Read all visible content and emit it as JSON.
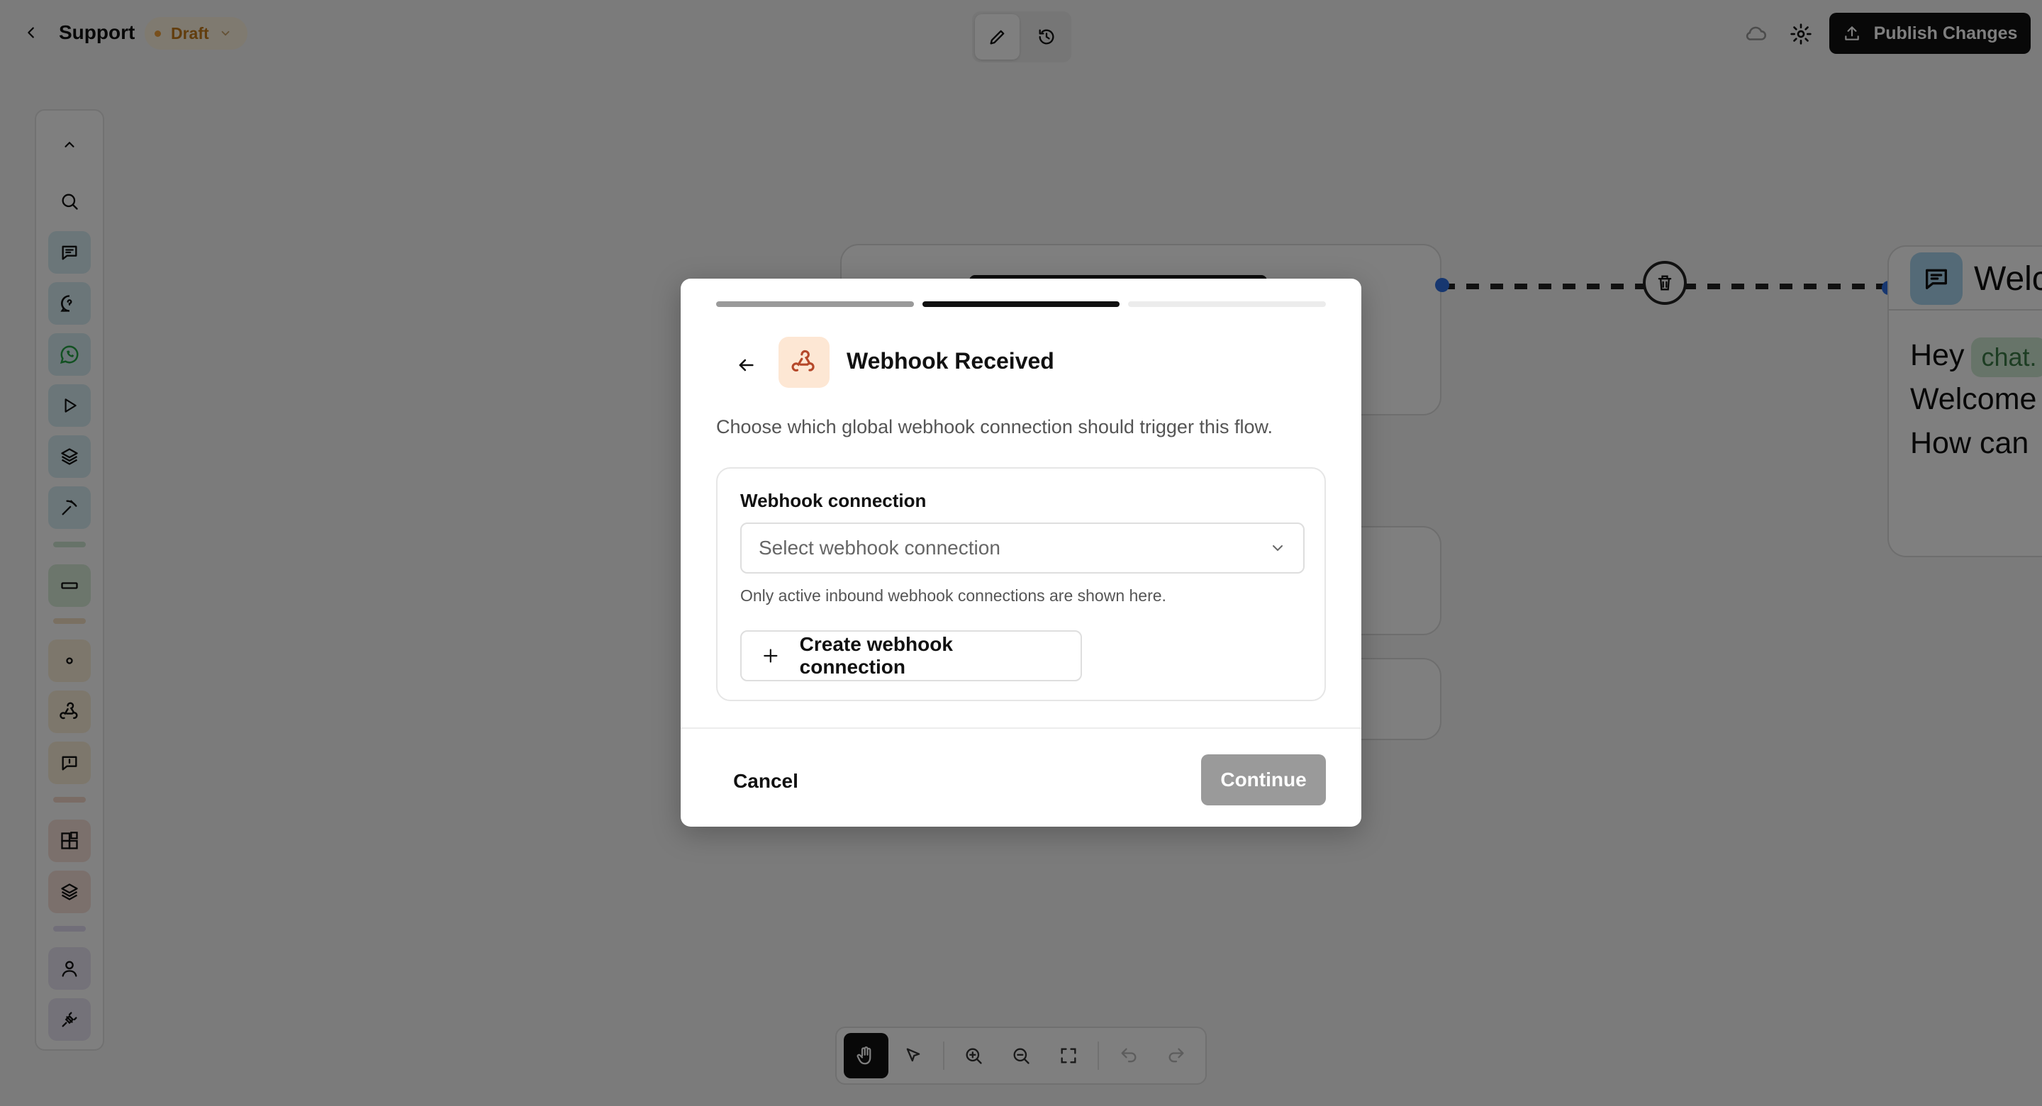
{
  "header": {
    "title": "Support",
    "status": "Draft",
    "publish_label": "Publish Changes"
  },
  "canvas": {
    "welcome_node": {
      "title": "Welc",
      "line1": "Hey",
      "variable": "chat.",
      "line2": "Welcome",
      "line3": "How can"
    }
  },
  "palette": {
    "items": [
      {
        "icon": "chevron-up-icon"
      },
      {
        "icon": "search-icon"
      },
      {
        "icon": "message-icon",
        "color": "#d6ecf3"
      },
      {
        "icon": "question-chat-icon",
        "color": "#d6ecf3"
      },
      {
        "icon": "whatsapp-icon",
        "color": "#d6ecf3"
      },
      {
        "icon": "play-icon",
        "color": "#d6ecf3"
      },
      {
        "icon": "layers-icon",
        "color": "#d6ecf3"
      },
      {
        "icon": "pickaxe-icon",
        "color": "#d6ecf3"
      },
      {
        "icon": "input-field-icon",
        "color": "#d8ecd9"
      },
      {
        "icon": "dot-icon",
        "color": "#fbefd8"
      },
      {
        "icon": "webhook-icon",
        "color": "#fbefd8"
      },
      {
        "icon": "chat-bubble-icon",
        "color": "#fbefd8"
      },
      {
        "icon": "blocks-icon",
        "color": "#f6e0d8"
      },
      {
        "icon": "layers-icon",
        "color": "#f6e0d8"
      },
      {
        "icon": "user-icon",
        "color": "#e8e4f3"
      },
      {
        "icon": "plug-icon",
        "color": "#e8e4f3"
      }
    ]
  },
  "modal": {
    "title": "Webhook Received",
    "description": "Choose which global webhook connection should trigger this flow.",
    "field_label": "Webhook connection",
    "select_placeholder": "Select webhook connection",
    "hint": "Only active inbound webhook connections are shown here.",
    "create_label": "Create webhook connection",
    "cancel_label": "Cancel",
    "continue_label": "Continue",
    "progress_steps": 3,
    "progress_current": 2
  },
  "toolbar": {
    "tools": [
      "hand-icon",
      "pointer-icon",
      "zoom-in-icon",
      "zoom-out-icon",
      "fit-screen-icon",
      "undo-icon",
      "redo-icon"
    ]
  },
  "colors": {
    "accent_dot": "#2f6fe0",
    "draft": "#c57a1a",
    "webhook_icon_bg": "#fde7d4",
    "continue_disabled": "#9a9a9a"
  }
}
